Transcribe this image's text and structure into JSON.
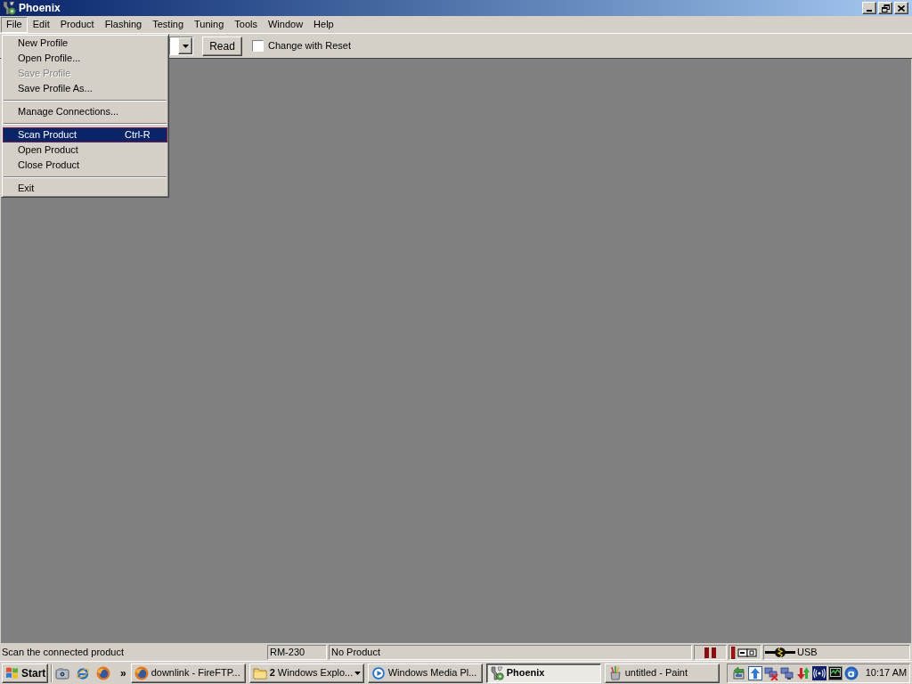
{
  "window": {
    "title": "Phoenix"
  },
  "menu_bar": [
    {
      "label": "File",
      "selected": true
    },
    {
      "label": "Edit",
      "selected": false
    },
    {
      "label": "Product",
      "selected": false
    },
    {
      "label": "Flashing",
      "selected": false
    },
    {
      "label": "Testing",
      "selected": false
    },
    {
      "label": "Tuning",
      "selected": false
    },
    {
      "label": "Tools",
      "selected": false
    },
    {
      "label": "Window",
      "selected": false
    },
    {
      "label": "Help",
      "selected": false
    }
  ],
  "file_menu": [
    {
      "kind": "item",
      "label": "New Profile",
      "disabled": false,
      "selected": false
    },
    {
      "kind": "item",
      "label": "Open Profile...",
      "disabled": false,
      "selected": false
    },
    {
      "kind": "item",
      "label": "Save Profile",
      "disabled": true,
      "selected": false
    },
    {
      "kind": "item",
      "label": "Save Profile As...",
      "disabled": false,
      "selected": false
    },
    {
      "kind": "separator"
    },
    {
      "kind": "item",
      "label": "Manage Connections...",
      "disabled": false,
      "selected": false
    },
    {
      "kind": "separator"
    },
    {
      "kind": "item",
      "label": "Scan Product",
      "shortcut": "Ctrl-R",
      "disabled": false,
      "selected": true
    },
    {
      "kind": "item",
      "label": "Open Product",
      "disabled": false,
      "selected": false
    },
    {
      "kind": "item",
      "label": "Close Product",
      "disabled": false,
      "selected": false
    },
    {
      "kind": "separator"
    },
    {
      "kind": "item",
      "label": "Exit",
      "disabled": false,
      "selected": false
    }
  ],
  "toolbar": {
    "read_button": "Read",
    "change_with_reset": {
      "label": "Change with Reset",
      "checked": false
    }
  },
  "status_bar": {
    "message": "Scan the connected product",
    "product_code": "RM-230",
    "product_name": "No Product",
    "connection": "USB"
  },
  "taskbar": {
    "start_button": "Start",
    "more_button": "»",
    "tasks": [
      {
        "kind": "window",
        "label": "downlink - FireFTP...",
        "selected": false
      },
      {
        "kind": "group",
        "count": "2",
        "label": "Windows Explo...",
        "selected": false
      },
      {
        "kind": "window",
        "label": "Windows Media Pl...",
        "selected": false
      },
      {
        "kind": "window",
        "label": "Phoenix",
        "selected": true
      },
      {
        "kind": "window",
        "label": "untitled - Paint",
        "selected": false
      }
    ],
    "clock": "10:17 AM"
  }
}
